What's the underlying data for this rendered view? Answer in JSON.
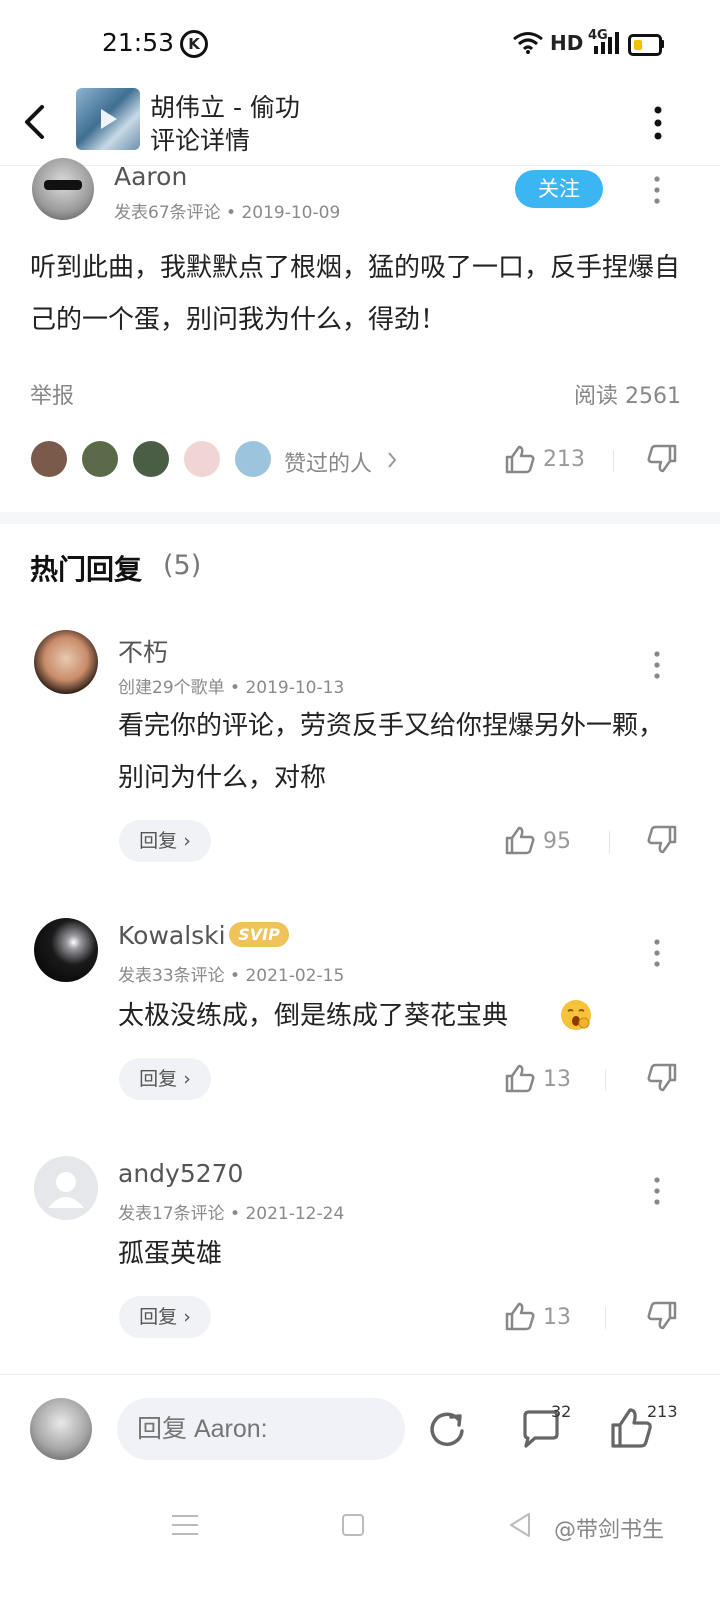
{
  "status_bar": {
    "time": "21:53",
    "k_badge": "K",
    "hd": "HD",
    "network": "4G",
    "battery_level": 0.35
  },
  "header": {
    "back_icon": "back-arrow-icon",
    "song_title": "胡伟立 - 偷功",
    "page_title": "评论详情",
    "more_icon": "more-vertical-icon"
  },
  "main_comment": {
    "username": "Aaron",
    "meta": "发表67条评论 • 2019-10-09",
    "follow_label": "关注",
    "content": "听到此曲，我默默点了根烟，猛的吸了一口，反手捏爆自己的一个蛋，别问我为什么，得劲！",
    "report_label": "举报",
    "read_count": "阅读 2561",
    "likers_label": "赞过的人",
    "like_count": "213"
  },
  "hot_replies": {
    "title": "热门回复",
    "count": "(5)",
    "items": [
      {
        "username": "不朽",
        "meta": "创建29个歌单 • 2019-10-13",
        "content": "看完你的评论，劳资反手又给你捏爆另外一颗，别问为什么，对称",
        "reply_label": "回复",
        "like_count": "95"
      },
      {
        "username": "Kowalski",
        "badge": "SVIP",
        "meta": "发表33条评论 • 2021-02-15",
        "content": "太极没练成，倒是练成了葵花宝典",
        "reply_label": "回复",
        "like_count": "13"
      },
      {
        "username": "andy5270",
        "meta": "发表17条评论 • 2021-12-24",
        "content": "孤蛋英雄",
        "reply_label": "回复",
        "like_count": "13"
      }
    ]
  },
  "bottom_bar": {
    "placeholder": "回复 Aaron:",
    "comment_count": "32",
    "like_count": "213"
  },
  "watermark": "@带剑书生",
  "colors": {
    "accent_blue": "#3cb6f2",
    "svip_gold": "#f0c35a",
    "battery_yellow": "#f2c200"
  }
}
